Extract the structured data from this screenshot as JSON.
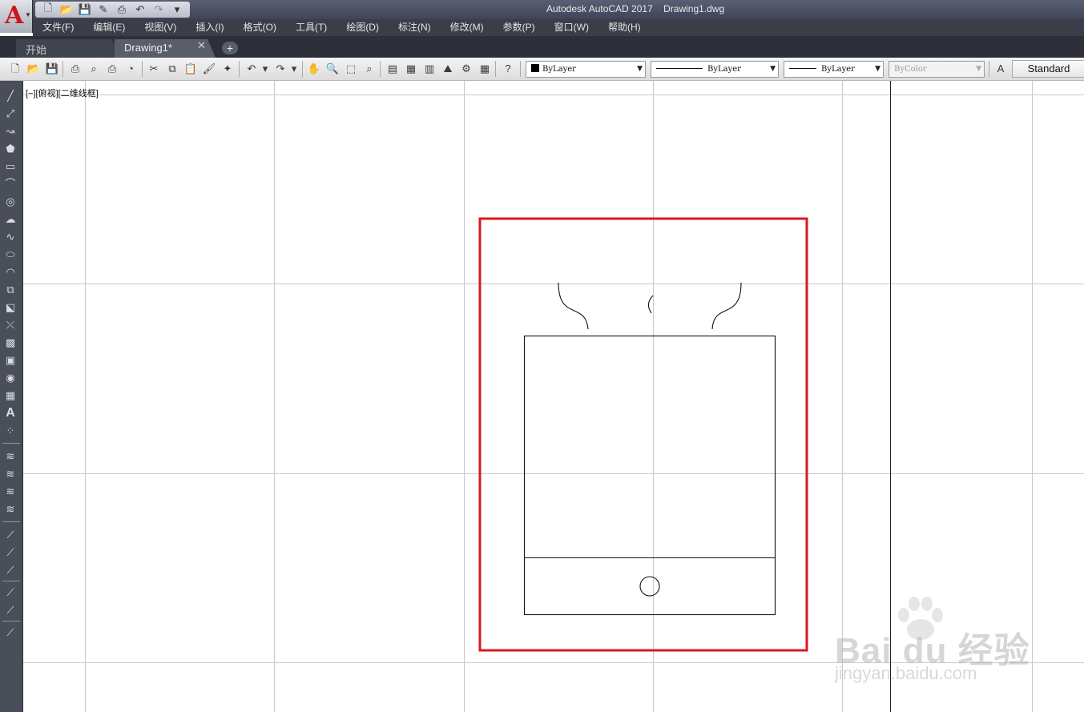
{
  "titlebar": {
    "app": "Autodesk AutoCAD 2017",
    "file": "Drawing1.dwg",
    "qat_icons": [
      "new-icon",
      "open-icon",
      "save-icon",
      "saveas-icon",
      "plot-icon",
      "undo-icon",
      "redo-icon",
      "customize-icon"
    ]
  },
  "menu": [
    "文件(F)",
    "编辑(E)",
    "视图(V)",
    "插入(I)",
    "格式(O)",
    "工具(T)",
    "绘图(D)",
    "标注(N)",
    "修改(M)",
    "参数(P)",
    "窗口(W)",
    "帮助(H)"
  ],
  "tabs": {
    "start": "开始",
    "drawing": "Drawing1*",
    "close": "✕",
    "new": "+"
  },
  "toolbar": {
    "color": "ByLayer",
    "linetype": "ByLayer",
    "lineweight": "ByLayer",
    "plotstyle": "ByColor",
    "text_style": "Standard"
  },
  "viewport": {
    "label": "[−][俯视][二维线框]"
  },
  "watermark": {
    "brand": "Bai du 经验",
    "url": "jingyan.baidu.com"
  },
  "colors": {
    "highlight_box": "#d9191d",
    "grid": "#c8c8c8",
    "drawing": "#111111"
  }
}
